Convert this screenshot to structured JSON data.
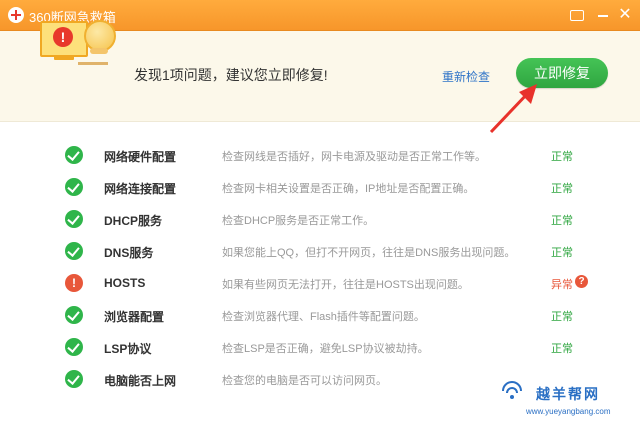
{
  "window": {
    "title": "360断网急救箱"
  },
  "header": {
    "message": "发现1项问题，建议您立即修复!",
    "recheck_label": "重新检查",
    "fix_label": "立即修复"
  },
  "items": [
    {
      "name": "网络硬件配置",
      "desc": "检查网线是否插好，网卡电源及驱动是否正常工作等。",
      "status": "正常",
      "state": "ok"
    },
    {
      "name": "网络连接配置",
      "desc": "检查网卡相关设置是否正确，IP地址是否配置正确。",
      "status": "正常",
      "state": "ok"
    },
    {
      "name": "DHCP服务",
      "desc": "检查DHCP服务是否正常工作。",
      "status": "正常",
      "state": "ok"
    },
    {
      "name": "DNS服务",
      "desc": "如果您能上QQ，但打不开网页，往往是DNS服务出现问题。",
      "status": "正常",
      "state": "ok"
    },
    {
      "name": "HOSTS",
      "desc": "如果有些网页无法打开，往往是HOSTS出现问题。",
      "status": "异常",
      "state": "error"
    },
    {
      "name": "浏览器配置",
      "desc": "检查浏览器代理、Flash插件等配置问题。",
      "status": "正常",
      "state": "ok"
    },
    {
      "name": "LSP协议",
      "desc": "检查LSP是否正确，避免LSP协议被劫持。",
      "status": "正常",
      "state": "ok"
    },
    {
      "name": "电脑能否上网",
      "desc": "检查您的电脑是否可以访问网页。",
      "status": "",
      "state": "ok"
    }
  ],
  "watermark": {
    "title": "越羊帮网",
    "url": "www.yueyangbang.com"
  },
  "colors": {
    "titlebar": "#f7962a",
    "ok": "#2fb54a",
    "error": "#e8573a",
    "link": "#2f74c8",
    "header_bg": "#fcf8ea"
  }
}
